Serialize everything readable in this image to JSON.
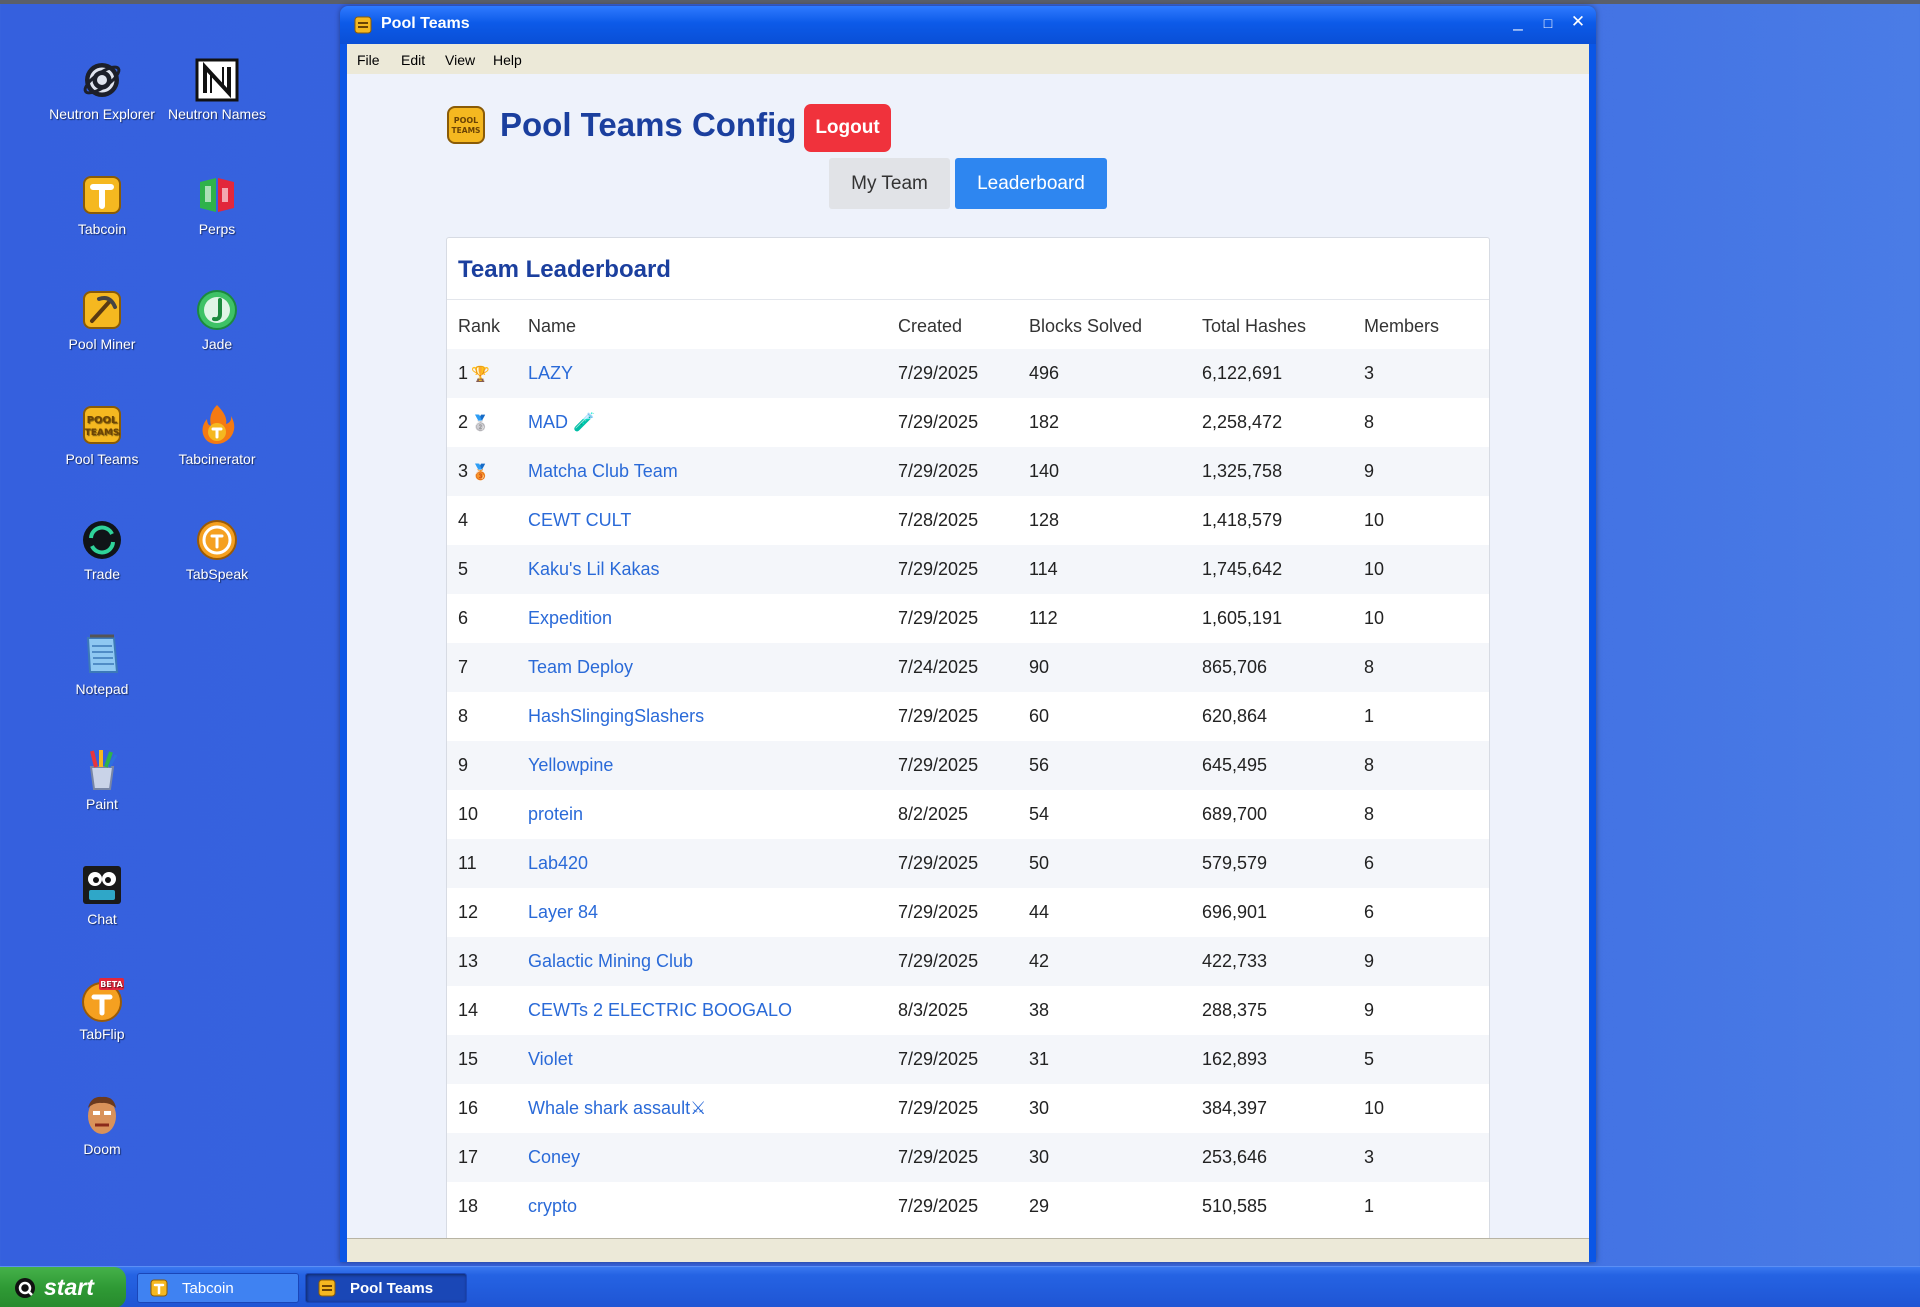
{
  "desktop": {
    "icons": [
      {
        "label": "Neutron Explorer",
        "icon": "neutron-explorer-icon"
      },
      {
        "label": "Neutron Names",
        "icon": "neutron-names-icon"
      },
      {
        "label": "Tabcoin",
        "icon": "tabcoin-icon"
      },
      {
        "label": "Perps",
        "icon": "perps-icon"
      },
      {
        "label": "Pool Miner",
        "icon": "pool-miner-icon"
      },
      {
        "label": "Jade",
        "icon": "jade-icon"
      },
      {
        "label": "Pool Teams",
        "icon": "pool-teams-icon"
      },
      {
        "label": "Tabcinerator",
        "icon": "tabcinerator-icon"
      },
      {
        "label": "Trade",
        "icon": "trade-icon"
      },
      {
        "label": "TabSpeak",
        "icon": "tabspeak-icon"
      },
      {
        "label": "Notepad",
        "icon": "notepad-icon"
      },
      {
        "label": "Paint",
        "icon": "paint-icon"
      },
      {
        "label": "Chat",
        "icon": "chat-icon"
      },
      {
        "label": "TabFlip",
        "icon": "tabflip-icon",
        "badge": "BETA"
      },
      {
        "label": "Doom",
        "icon": "doom-icon"
      }
    ]
  },
  "window": {
    "title": "Pool Teams",
    "logo_text": "POOL TEAMS",
    "controls": {
      "minimize": "_",
      "maximize": "□",
      "close": "✕"
    },
    "menu": [
      "File",
      "Edit",
      "View",
      "Help"
    ]
  },
  "app": {
    "title": "Pool Teams Config",
    "logout_label": "Logout",
    "tabs": [
      {
        "label": "My Team",
        "active": false
      },
      {
        "label": "Leaderboard",
        "active": true
      }
    ],
    "leaderboard": {
      "title": "Team Leaderboard",
      "columns": [
        "Rank",
        "Name",
        "Created",
        "Blocks Solved",
        "Total Hashes",
        "Members"
      ],
      "rows": [
        {
          "rank": "1",
          "medal": "🏆",
          "name": "LAZY",
          "created": "7/29/2025",
          "blocks": "496",
          "hashes": "6,122,691",
          "members": "3"
        },
        {
          "rank": "2",
          "medal": "🥈",
          "name": "MAD 🧪",
          "created": "7/29/2025",
          "blocks": "182",
          "hashes": "2,258,472",
          "members": "8"
        },
        {
          "rank": "3",
          "medal": "🥉",
          "name": "Matcha Club Team",
          "created": "7/29/2025",
          "blocks": "140",
          "hashes": "1,325,758",
          "members": "9"
        },
        {
          "rank": "4",
          "medal": "",
          "name": "CEWT CULT",
          "created": "7/28/2025",
          "blocks": "128",
          "hashes": "1,418,579",
          "members": "10"
        },
        {
          "rank": "5",
          "medal": "",
          "name": "Kaku's Lil Kakas",
          "created": "7/29/2025",
          "blocks": "114",
          "hashes": "1,745,642",
          "members": "10"
        },
        {
          "rank": "6",
          "medal": "",
          "name": "Expedition",
          "created": "7/29/2025",
          "blocks": "112",
          "hashes": "1,605,191",
          "members": "10"
        },
        {
          "rank": "7",
          "medal": "",
          "name": "Team Deploy",
          "created": "7/24/2025",
          "blocks": "90",
          "hashes": "865,706",
          "members": "8"
        },
        {
          "rank": "8",
          "medal": "",
          "name": "HashSlingingSlashers",
          "created": "7/29/2025",
          "blocks": "60",
          "hashes": "620,864",
          "members": "1"
        },
        {
          "rank": "9",
          "medal": "",
          "name": "Yellowpine",
          "created": "7/29/2025",
          "blocks": "56",
          "hashes": "645,495",
          "members": "8"
        },
        {
          "rank": "10",
          "medal": "",
          "name": "protein",
          "created": "8/2/2025",
          "blocks": "54",
          "hashes": "689,700",
          "members": "8"
        },
        {
          "rank": "11",
          "medal": "",
          "name": "Lab420",
          "created": "7/29/2025",
          "blocks": "50",
          "hashes": "579,579",
          "members": "6"
        },
        {
          "rank": "12",
          "medal": "",
          "name": "Layer 84",
          "created": "7/29/2025",
          "blocks": "44",
          "hashes": "696,901",
          "members": "6"
        },
        {
          "rank": "13",
          "medal": "",
          "name": "Galactic Mining Club",
          "created": "7/29/2025",
          "blocks": "42",
          "hashes": "422,733",
          "members": "9"
        },
        {
          "rank": "14",
          "medal": "",
          "name": "CEWTs 2 ELECTRIC BOOGALO",
          "created": "8/3/2025",
          "blocks": "38",
          "hashes": "288,375",
          "members": "9"
        },
        {
          "rank": "15",
          "medal": "",
          "name": "Violet",
          "created": "7/29/2025",
          "blocks": "31",
          "hashes": "162,893",
          "members": "5"
        },
        {
          "rank": "16",
          "medal": "",
          "name": "Whale shark assault⚔",
          "created": "7/29/2025",
          "blocks": "30",
          "hashes": "384,397",
          "members": "10"
        },
        {
          "rank": "17",
          "medal": "",
          "name": "Coney",
          "created": "7/29/2025",
          "blocks": "30",
          "hashes": "253,646",
          "members": "3"
        },
        {
          "rank": "18",
          "medal": "",
          "name": "crypto",
          "created": "7/29/2025",
          "blocks": "29",
          "hashes": "510,585",
          "members": "1"
        }
      ]
    }
  },
  "taskbar": {
    "start_label": "start",
    "tasks": [
      {
        "label": "Tabcoin",
        "active": false
      },
      {
        "label": "Pool Teams",
        "active": true
      }
    ]
  },
  "colors": {
    "desktop": "#3a67e0",
    "titlebar": "#0c5ae8",
    "accent": "#2e86f0",
    "logout": "#f0323c",
    "heading": "#1b3f9e",
    "link": "#2a6ad8",
    "gold": "#f5b820"
  }
}
